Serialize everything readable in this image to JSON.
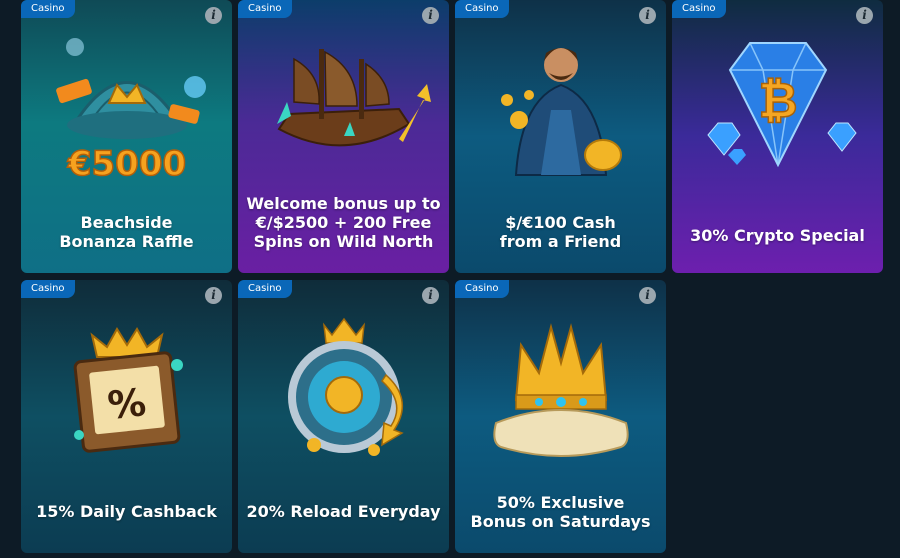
{
  "cards": [
    {
      "badge": "Casino",
      "title_lines": [
        "Beachside",
        "Bonanza Raffle"
      ],
      "art_text": "€5000"
    },
    {
      "badge": "Casino",
      "title_lines": [
        "Welcome bonus up to",
        "€/$2500 + 200 Free",
        "Spins on Wild North"
      ]
    },
    {
      "badge": "Casino",
      "title_lines": [
        "$/€100 Cash",
        "from a Friend"
      ]
    },
    {
      "badge": "Casino",
      "title_lines": [
        "30% Crypto Special"
      ],
      "art_text": "₿"
    },
    {
      "badge": "Casino",
      "title_lines": [
        "15% Daily Cashback"
      ],
      "art_text": "%"
    },
    {
      "badge": "Casino",
      "title_lines": [
        "20% Reload Everyday"
      ]
    },
    {
      "badge": "Casino",
      "title_lines": [
        "50% Exclusive",
        "Bonus on Saturdays"
      ]
    }
  ],
  "info_icon": "info-icon",
  "colors": {
    "badge": "#0a67b8",
    "page_bg": "#0d1b26",
    "gold": "#f3b22a"
  }
}
